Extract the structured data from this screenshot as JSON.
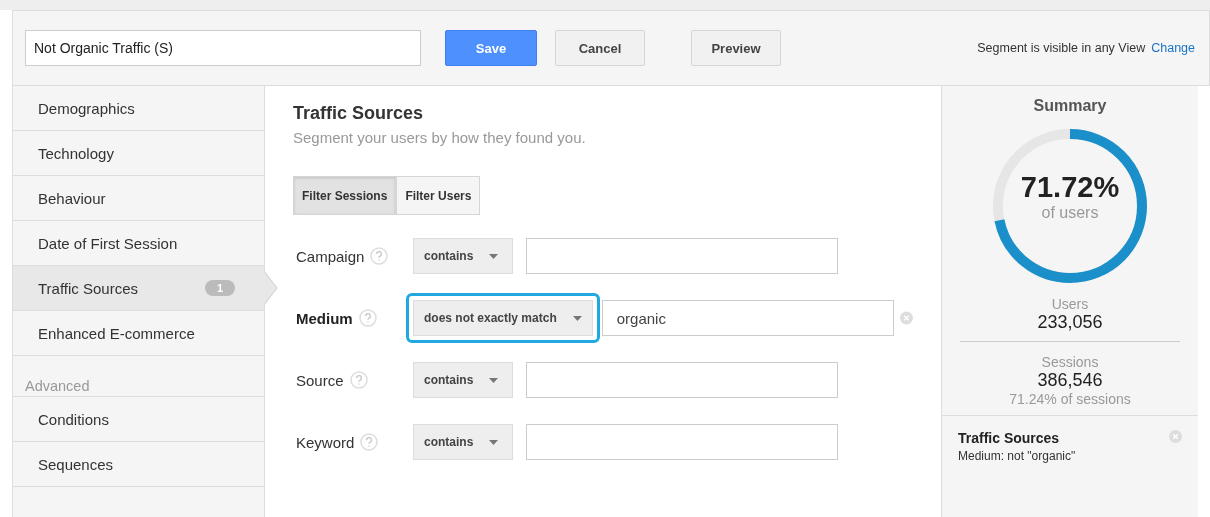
{
  "segment_name": {
    "value": "Not Organic Traffic (S)"
  },
  "buttons": [
    {
      "label": "Save",
      "kind": "primary"
    },
    {
      "label": "Cancel",
      "kind": "plain"
    },
    {
      "label": "Preview",
      "kind": "plain"
    }
  ],
  "visibility": {
    "text": "Segment is visible in any View",
    "link": "Change"
  },
  "sidebar": {
    "items": [
      {
        "label": "Demographics",
        "selected": false
      },
      {
        "label": "Technology",
        "selected": false
      },
      {
        "label": "Behaviour",
        "selected": false
      },
      {
        "label": "Date of First Session",
        "selected": false
      },
      {
        "label": "Traffic Sources",
        "selected": true,
        "badge": "1"
      },
      {
        "label": "Enhanced E-commerce",
        "selected": false
      }
    ],
    "advanced": {
      "heading": "Advanced",
      "items": [
        {
          "label": "Conditions",
          "selected": false
        },
        {
          "label": "Sequences",
          "selected": false
        }
      ]
    }
  },
  "panel": {
    "title": "Traffic Sources",
    "subtitle": "Segment your users by how they found you.",
    "filter_tabs": [
      {
        "label": "Filter Sessions",
        "selected": true
      },
      {
        "label": "Filter Users",
        "selected": false
      }
    ],
    "conditions": [
      {
        "label": "Campaign",
        "operator": "contains",
        "active": false
      },
      {
        "label": "Medium",
        "operator": "does not exactly match",
        "value": "organic",
        "active": true
      },
      {
        "label": "Source",
        "operator": "contains",
        "active": false
      },
      {
        "label": "Keyword",
        "operator": "contains",
        "active": false
      }
    ]
  },
  "summary": {
    "title": "Summary",
    "percent": "71.72%",
    "percent_label": "of users",
    "level": 0.7172,
    "users_label": "Users",
    "users": "233,056",
    "sessions_label": "Sessions",
    "sessions": "386,546",
    "sessions_share": "71.24% of sessions",
    "filter": {
      "title": "Traffic Sources",
      "description": "Medium: not \"organic\""
    }
  }
}
